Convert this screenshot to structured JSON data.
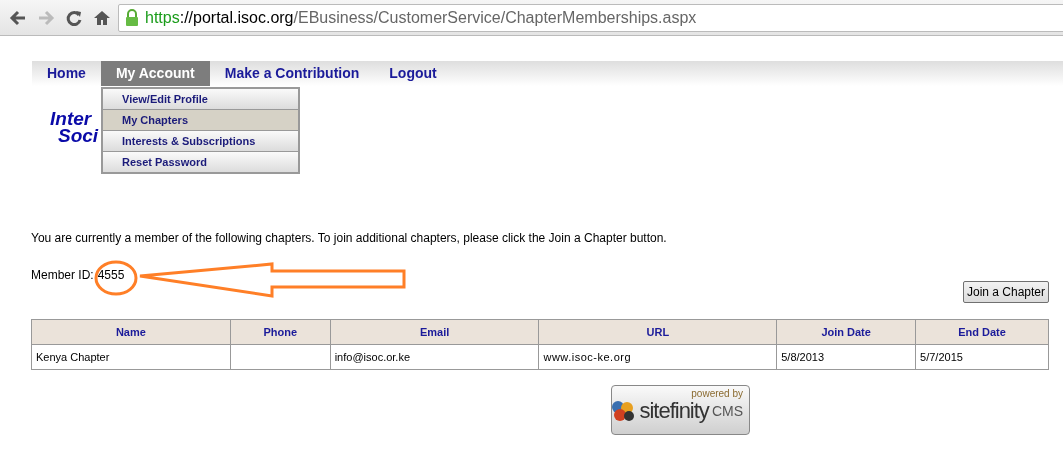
{
  "browser": {
    "url_scheme": "https",
    "url_host": "://portal.isoc.org",
    "url_path": "/EBusiness/CustomerService/ChapterMemberships.aspx"
  },
  "nav": [
    {
      "label": "Home",
      "selected": false
    },
    {
      "label": "My Account",
      "selected": true,
      "menu": [
        {
          "label": "View/Edit Profile",
          "selected": false
        },
        {
          "label": "My Chapters",
          "selected": true
        },
        {
          "label": "Interests & Subscriptions",
          "selected": false
        },
        {
          "label": "Reset Password",
          "selected": false
        }
      ]
    },
    {
      "label": "Make a Contribution",
      "selected": false
    },
    {
      "label": "Logout",
      "selected": false
    }
  ],
  "logo": [
    "Inter",
    "Soci"
  ],
  "intro": "You are currently a member of the following chapters. To join additional chapters, please click the Join a Chapter button.",
  "member_id": {
    "label": "Member ID:",
    "value": "4555"
  },
  "join_button": "Join a Chapter",
  "table": {
    "columns": [
      "Name",
      "Phone",
      "Email",
      "URL",
      "Join Date",
      "End Date"
    ],
    "rows": [
      [
        "Kenya Chapter",
        "",
        "info@isoc.or.ke",
        "www.isoc-ke.org",
        "5/8/2013",
        "5/7/2015"
      ]
    ]
  },
  "footer_badge": {
    "top": "powered by",
    "brand": "sitefinity",
    "suffix": "CMS"
  }
}
